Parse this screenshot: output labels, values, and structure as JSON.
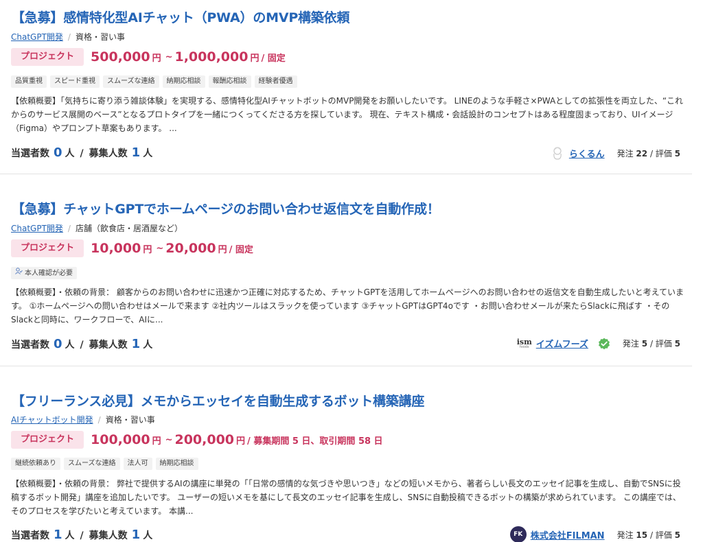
{
  "listings": [
    {
      "title": "【急募】感情特化型AIチャット（PWA）のMVP構築依頼",
      "category_link": "ChatGPT開発",
      "category_sub": "資格・習い事",
      "badge": "プロジェクト",
      "price_min": "500,000",
      "price_max": "1,000,000",
      "yen": "円",
      "tilde": "~",
      "price_suffix": "/ 固定",
      "tags": [
        "品質重視",
        "スピード重視",
        "スムーズな連絡",
        "納期応相談",
        "報酬応相談",
        "経験者優遇"
      ],
      "description": "【依頼概要】「気持ちに寄り添う雑談体験」を実現する、感情特化型AIチャットボットのMVP開発をお願いしたいです。 LINEのような手軽さ×PWAとしての拡張性を両立した、“これからのサービス展開のベース”となるプロトタイプを一緒につくってくださる方を探しています。 現在、テキスト構成・会話設計のコンセプトはある程度固まっており、UIイメージ（Figma）やプロンプト草案もあります。 ...",
      "selected_label": "当選者数",
      "selected_count": "0",
      "recruit_label": "募集人数",
      "recruit_count": "1",
      "person_unit": "人",
      "client_name": "らくるん",
      "orders_label": "発注",
      "orders": "22",
      "rating_label": "評価",
      "rating": "5"
    },
    {
      "title": "【急募】チャットGPTでホームページのお問い合わせ返信文を自動作成！",
      "category_link": "ChatGPT開発",
      "category_sub": "店舗（飲食店・居酒屋など）",
      "badge": "プロジェクト",
      "price_min": "10,000",
      "price_max": "20,000",
      "yen": "円",
      "tilde": "~",
      "price_suffix": "/ 固定",
      "tags": [
        "本人確認が必要"
      ],
      "description": "【依頼概要】・依頼の背景： 顧客からのお問い合わせに迅速かつ正確に対応するため、チャットGPTを活用してホームページへのお問い合わせの返信文を自動生成したいと考えています。 ①ホームページへの問い合わせはメールで来ます ②社内ツールはスラックを使っています ③チャットGPTはGPT4oです ・お問い合わせメールが来たらSlackに飛ばす ・そのSlackと同時に、ワークフローで、AIに...",
      "selected_label": "当選者数",
      "selected_count": "0",
      "recruit_label": "募集人数",
      "recruit_count": "1",
      "person_unit": "人",
      "client_logo_text": "ism",
      "client_logo_sub": "foods",
      "client_name": "イズムフーズ",
      "orders_label": "発注",
      "orders": "5",
      "rating_label": "評価",
      "rating": "5"
    },
    {
      "title": "【フリーランス必見】メモからエッセイを自動生成するボット構築講座",
      "category_link": "AIチャットボット開発",
      "category_sub": "資格・習い事",
      "badge": "プロジェクト",
      "price_min": "100,000",
      "price_max": "200,000",
      "yen": "円",
      "tilde": "~",
      "price_suffix": "/ 募集期間 5 日、取引期間 58 日",
      "tags": [
        "継続依頼あり",
        "スムーズな連絡",
        "法人可",
        "納期応相談"
      ],
      "description": "【依頼概要】・依頼の背景： 弊社で提供するAIの講座に単発の「「日常の感情的な気づきや思いつき」などの短いメモから、著者らしい長文のエッセイ記事を生成し、自動でSNSに投稿するボット開発」講座を追加したいです。 ユーザーの短いメモを基にして長文のエッセイ記事を生成し、SNSに自動投稿できるボットの構築が求められています。 この講座では、そのプロセスを学びたいと考えています。 本講...",
      "selected_label": "当選者数",
      "selected_count": "1",
      "recruit_label": "募集人数",
      "recruit_count": "1",
      "person_unit": "人",
      "client_logo_text": "FK",
      "client_name": "株式会社FILMAN",
      "orders_label": "発注",
      "orders": "15",
      "rating_label": "評価",
      "rating": "5"
    }
  ],
  "icons": {
    "verified": "verified-check-icon",
    "person_check": "person-check-icon",
    "avatar": "user-avatar-icon"
  },
  "colors": {
    "title": "#2565b6",
    "price": "#c8345d",
    "badge_bg": "#fae3ea",
    "verified": "#5cb85c"
  }
}
